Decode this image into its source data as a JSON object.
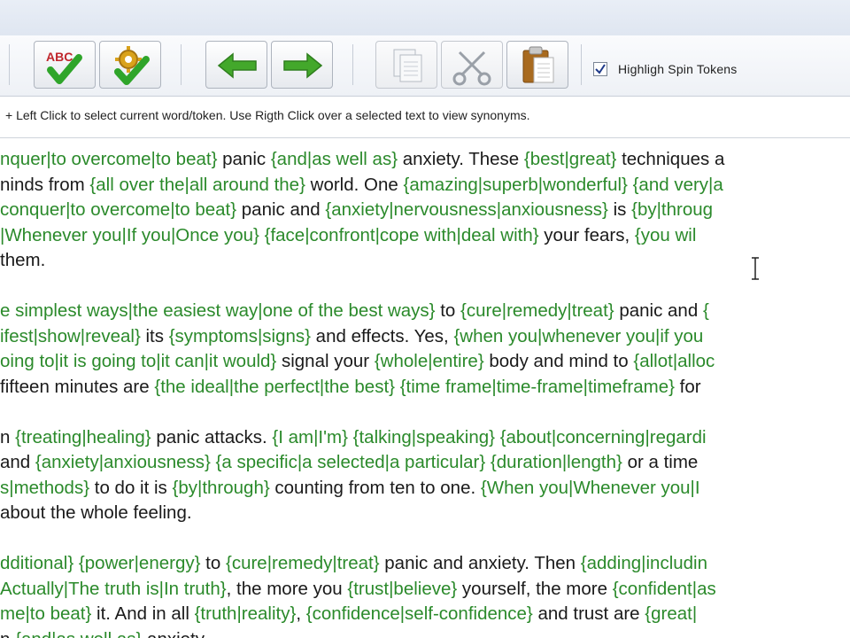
{
  "toolbar": {
    "buttons": [
      {
        "name": "spell-check-button",
        "icon": "abc-check-icon"
      },
      {
        "name": "spin-settings-button",
        "icon": "gear-check-icon"
      },
      {
        "name": "undo-button",
        "icon": "arrow-left-icon"
      },
      {
        "name": "redo-button",
        "icon": "arrow-right-icon"
      },
      {
        "name": "copy-button",
        "icon": "copy-icon"
      },
      {
        "name": "cut-button",
        "icon": "scissors-icon"
      },
      {
        "name": "paste-button",
        "icon": "paste-icon"
      }
    ],
    "abc_text": "ABC",
    "highlight_label": "Highligh Spin Tokens",
    "highlight_checked": true
  },
  "hint": "+ Left Click to select current word/token.  Use Rigth Click over a selected text to view synonyms.",
  "colors": {
    "token": "#2b8a2b",
    "text": "#1a1a1a",
    "arrow": "#43a82b",
    "check": "#2fa52a"
  },
  "editor": {
    "paragraphs": [
      [
        [
          {
            "x": "nquer|to overcome|to beat}"
          },
          {
            "p": " panic "
          },
          {
            "x": "{and|as well as}"
          },
          {
            "p": " anxiety. These "
          },
          {
            "x": "{best|great}"
          },
          {
            "p": " techniques a"
          }
        ],
        [
          {
            "p": "ninds from "
          },
          {
            "x": "{all over the|all around the}"
          },
          {
            "p": " world. One "
          },
          {
            "x": "{amazing|superb|wonderful}"
          },
          {
            "p": " "
          },
          {
            "x": "{and very|a"
          }
        ],
        [
          {
            "x": "conquer|to overcome|to beat}"
          },
          {
            "p": " panic and "
          },
          {
            "x": "{anxiety|nervousness|anxiousness}"
          },
          {
            "p": " is "
          },
          {
            "x": "{by|throug"
          }
        ],
        [
          {
            "x": "|Whenever you|If you|Once you}"
          },
          {
            "p": " "
          },
          {
            "x": "{face|confront|cope with|deal with}"
          },
          {
            "p": " your fears, "
          },
          {
            "x": "{you wil"
          }
        ],
        [
          {
            "p": "them."
          }
        ]
      ],
      [
        [
          {
            "x": "e simplest ways|the easiest way|one of the best ways}"
          },
          {
            "p": " to "
          },
          {
            "x": "{cure|remedy|treat}"
          },
          {
            "p": " panic and "
          },
          {
            "x": "{"
          }
        ],
        [
          {
            "x": "ifest|show|reveal}"
          },
          {
            "p": " its "
          },
          {
            "x": "{symptoms|signs}"
          },
          {
            "p": " and effects. Yes, "
          },
          {
            "x": "{when you|whenever you|if you"
          }
        ],
        [
          {
            "x": "oing to|it is going to|it can|it would}"
          },
          {
            "p": " signal your "
          },
          {
            "x": "{whole|entire}"
          },
          {
            "p": " body and mind to "
          },
          {
            "x": "{allot|alloc"
          }
        ],
        [
          {
            "p": " fifteen minutes are "
          },
          {
            "x": "{the ideal|the perfect|the best}"
          },
          {
            "p": " "
          },
          {
            "x": "{time frame|time-frame|timeframe}"
          },
          {
            "p": " for"
          }
        ]
      ],
      [
        [
          {
            "p": "n "
          },
          {
            "x": "{treating|healing}"
          },
          {
            "p": " panic attacks. "
          },
          {
            "x": "{I am|I'm}"
          },
          {
            "p": " "
          },
          {
            "x": "{talking|speaking}"
          },
          {
            "p": " "
          },
          {
            "x": "{about|concerning|regardi"
          }
        ],
        [
          {
            "p": " and "
          },
          {
            "x": "{anxiety|anxiousness}"
          },
          {
            "p": " "
          },
          {
            "x": "{a specific|a selected|a particular}"
          },
          {
            "p": " "
          },
          {
            "x": "{duration|length}"
          },
          {
            "p": " or a time"
          }
        ],
        [
          {
            "x": "s|methods}"
          },
          {
            "p": " to do it is "
          },
          {
            "x": "{by|through}"
          },
          {
            "p": " counting from ten to one. "
          },
          {
            "x": "{When you|Whenever you|I"
          }
        ],
        [
          {
            "p": " about the whole feeling."
          }
        ]
      ],
      [
        [
          {
            "x": "dditional}"
          },
          {
            "p": " "
          },
          {
            "x": "{power|energy}"
          },
          {
            "p": " to "
          },
          {
            "x": "{cure|remedy|treat}"
          },
          {
            "p": " panic and anxiety. Then "
          },
          {
            "x": "{adding|includin"
          }
        ],
        [
          {
            "x": "Actually|The truth is|In truth}"
          },
          {
            "p": ", the more you "
          },
          {
            "x": "{trust|believe}"
          },
          {
            "p": " yourself, the more "
          },
          {
            "x": "{confident|as"
          }
        ],
        [
          {
            "x": "me|to beat}"
          },
          {
            "p": " it. And in all "
          },
          {
            "x": "{truth|reality}"
          },
          {
            "p": ", "
          },
          {
            "x": "{confidence|self-confidence}"
          },
          {
            "p": " and trust are "
          },
          {
            "x": "{great|"
          }
        ],
        [
          {
            "p": "n "
          },
          {
            "x": "{and|as well as}"
          },
          {
            "p": " anxiety."
          }
        ]
      ]
    ]
  }
}
